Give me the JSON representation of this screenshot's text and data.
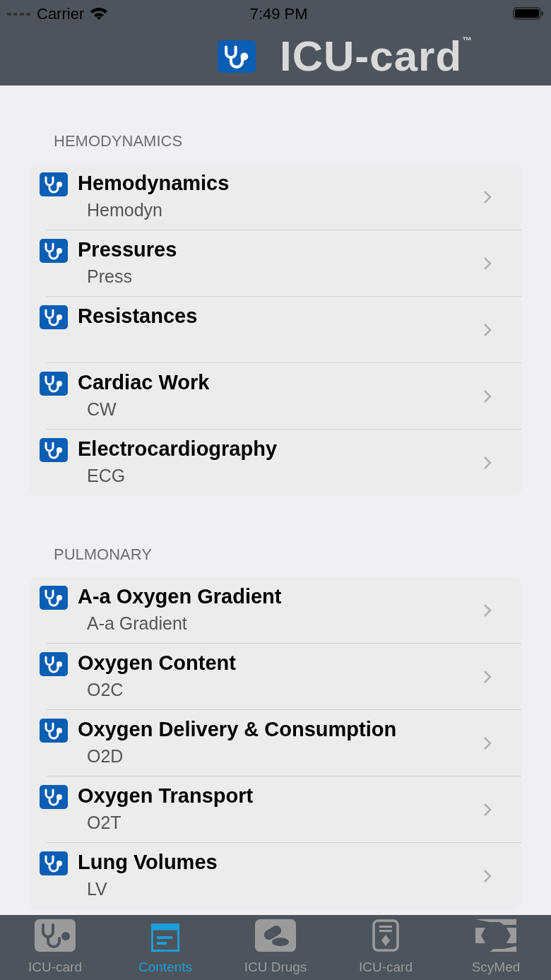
{
  "status_bar": {
    "carrier": "Carrier",
    "time": "7:49 PM"
  },
  "header": {
    "logo_text": "ICU-card",
    "trademark": "™"
  },
  "sections": [
    {
      "title": "HEMODYNAMICS",
      "items": [
        {
          "title": "Hemodynamics",
          "subtitle": "Hemodyn"
        },
        {
          "title": "Pressures",
          "subtitle": "Press"
        },
        {
          "title": "Resistances"
        },
        {
          "title": "Cardiac Work",
          "subtitle": "CW"
        },
        {
          "title": "Electrocardiography",
          "subtitle": "ECG"
        }
      ]
    },
    {
      "title": "PULMONARY",
      "items": [
        {
          "title": "A-a Oxygen Gradient",
          "subtitle": "A-a Gradient"
        },
        {
          "title": "Oxygen Content",
          "subtitle": "O2C"
        },
        {
          "title": "Oxygen Delivery & Consumption",
          "subtitle": "O2D"
        },
        {
          "title": "Oxygen Transport",
          "subtitle": "O2T"
        },
        {
          "title": "Lung Volumes",
          "subtitle": "LV"
        }
      ]
    }
  ],
  "tab_bar": [
    {
      "label": "ICU-card",
      "kind": "stethoscope",
      "selected": false
    },
    {
      "label": "Contents",
      "kind": "contents",
      "selected": true
    },
    {
      "label": "ICU Drugs",
      "kind": "drugs",
      "selected": false
    },
    {
      "label": "ICU-card",
      "kind": "card",
      "selected": false
    },
    {
      "label": "ScyMed",
      "kind": "scymed",
      "selected": false
    }
  ]
}
